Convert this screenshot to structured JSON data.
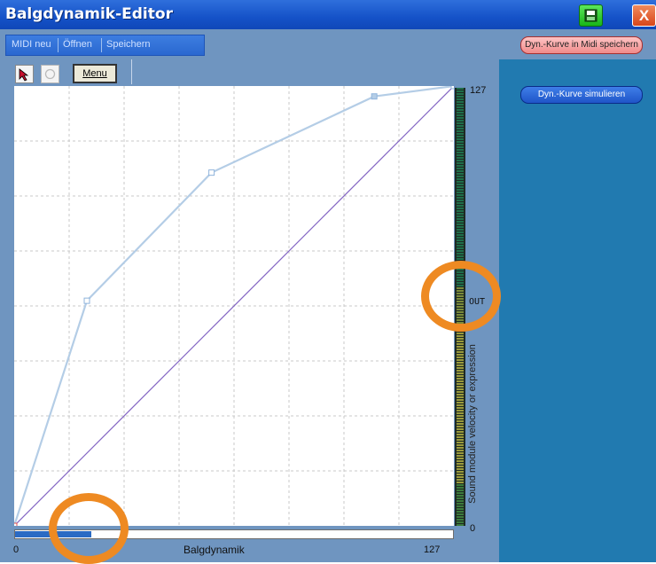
{
  "window": {
    "title": "Balgdynamik-Editor",
    "close_glyph": "X"
  },
  "menu": {
    "items": [
      "MIDI neu",
      "Öffnen",
      "Speichern"
    ]
  },
  "toolbar": {
    "menu_label": "Menu"
  },
  "buttons": {
    "save_curve": "Dyn.-Kurve in Midi speichern",
    "simulate_curve": "Dyn.-Kurve simulieren"
  },
  "chart_data": {
    "type": "line",
    "xlabel": "Balgdynamik",
    "ylabel": "Sound module velocity or expression",
    "xlim": [
      0,
      127
    ],
    "ylim": [
      0,
      127
    ],
    "grid": true,
    "series": [
      {
        "name": "",
        "x": [
          0,
          21,
          57,
          104,
          127
        ],
        "y": [
          0,
          65,
          102,
          124,
          127
        ],
        "color": "#b4cde6"
      },
      {
        "name": "",
        "x": [
          0,
          127
        ],
        "y": [
          0,
          127
        ],
        "color": "#8466c4"
      }
    ]
  },
  "axis_labels": {
    "x_min": "0",
    "x_max": "127",
    "y_min": "0",
    "y_max": "127",
    "out": "OUT"
  },
  "input_meter": {
    "value": 22
  },
  "colors": {
    "title_bar": "#1552c8",
    "panel_right": "#217ab0",
    "editor_bg": "#6f95c0",
    "curve": "#b4cde6",
    "diagonal": "#8466c4",
    "highlight": "#ee8a22"
  }
}
